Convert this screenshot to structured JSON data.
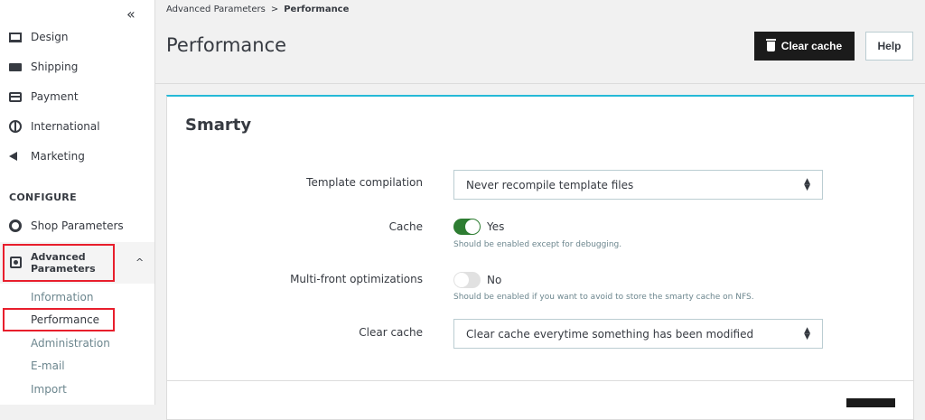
{
  "sidebar": {
    "collapse_glyph": "«",
    "items": [
      {
        "label": "Design",
        "icon": "desktop-icon"
      },
      {
        "label": "Shipping",
        "icon": "truck-icon"
      },
      {
        "label": "Payment",
        "icon": "credit-card-icon"
      },
      {
        "label": "International",
        "icon": "globe-icon"
      },
      {
        "label": "Marketing",
        "icon": "megaphone-icon"
      }
    ],
    "section_title": "CONFIGURE",
    "shop_parameters": "Shop Parameters",
    "advanced_parameters": "Advanced\nParameters",
    "advanced_chevron": "^",
    "subitems": [
      "Information",
      "Performance",
      "Administration",
      "E-mail",
      "Import"
    ]
  },
  "header": {
    "breadcrumb_parent": "Advanced Parameters",
    "breadcrumb_sep": ">",
    "breadcrumb_current": "Performance",
    "title": "Performance",
    "clear_cache_label": "Clear cache",
    "help_label": "Help"
  },
  "card": {
    "title": "Smarty",
    "template_compilation": {
      "label": "Template compilation",
      "value": "Never recompile template files"
    },
    "cache": {
      "label": "Cache",
      "state": "Yes",
      "help": "Should be enabled except for debugging."
    },
    "multi_front": {
      "label": "Multi-front optimizations",
      "state": "No",
      "help": "Should be enabled if you want to avoid to store the smarty cache on NFS."
    },
    "clear_cache": {
      "label": "Clear cache",
      "value": "Clear cache everytime something has been modified"
    }
  },
  "colors": {
    "accent": "#25b9d7",
    "toggle_on": "#2e7d32",
    "highlight": "#e81e2c",
    "dark_button": "#1b1b1b"
  }
}
